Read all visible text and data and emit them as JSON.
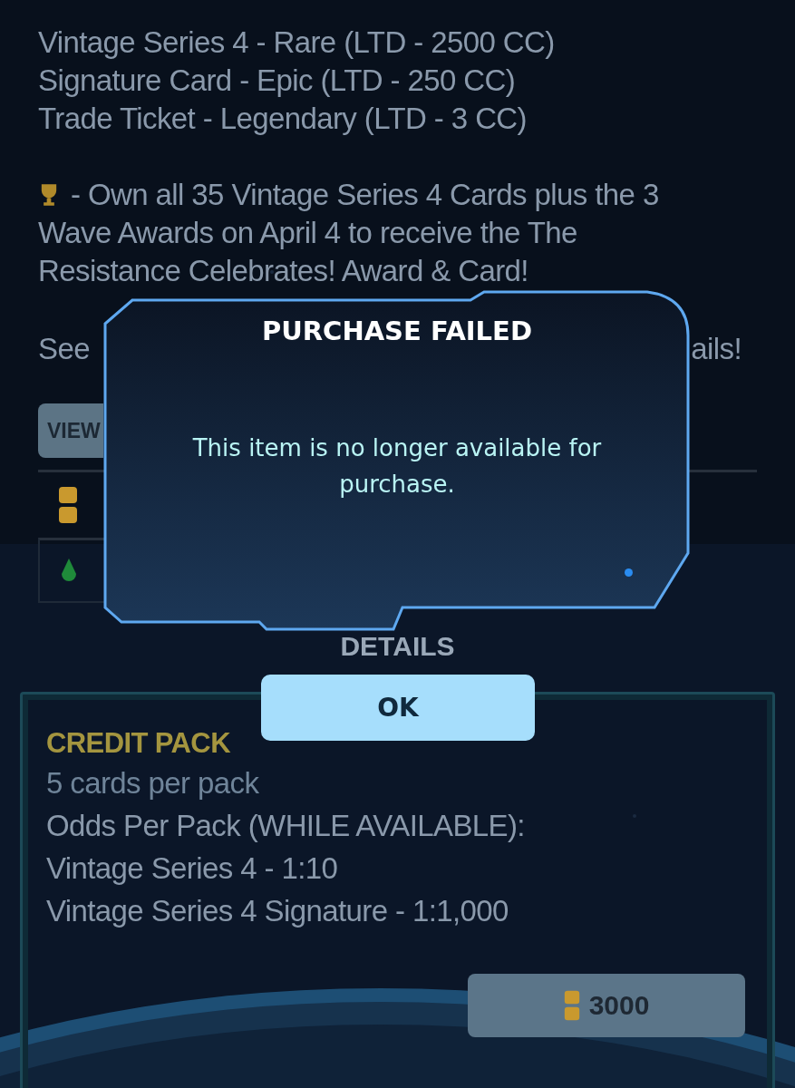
{
  "background": {
    "rarity_lines": [
      "Vintage Series 4 - Rare (LTD - 2500 CC)",
      "Signature Card - Epic (LTD - 250 CC)",
      "Trade Ticket - Legendary (LTD - 3 CC)"
    ],
    "award_lines": [
      "- Own all 35 Vintage Series 4 Cards plus the 3",
      "Wave Awards on April 4 to receive the The",
      "Resistance Celebrates! Award & Card!"
    ],
    "transmission_note": {
      "start": "See",
      "end": "ails!"
    },
    "set_progress_button": "VIEW",
    "costs": [
      {
        "kind": "coin"
      },
      {
        "kind": "gem"
      }
    ],
    "details_label": "DETAILS",
    "credit_pack": {
      "title": "CREDIT PACK",
      "subtitle": "5 cards per pack",
      "odds_heading": "Odds Per Pack (WHILE AVAILABLE):",
      "odds": [
        "Vintage Series 4 - 1:10",
        "Vintage Series 4 Signature - 1:1,000"
      ],
      "price": {
        "kind": "coin",
        "amount": "3000"
      }
    }
  },
  "dialog": {
    "title": "PURCHASE FAILED",
    "message": "This item is no longer available for purchase.",
    "button": "OK"
  }
}
